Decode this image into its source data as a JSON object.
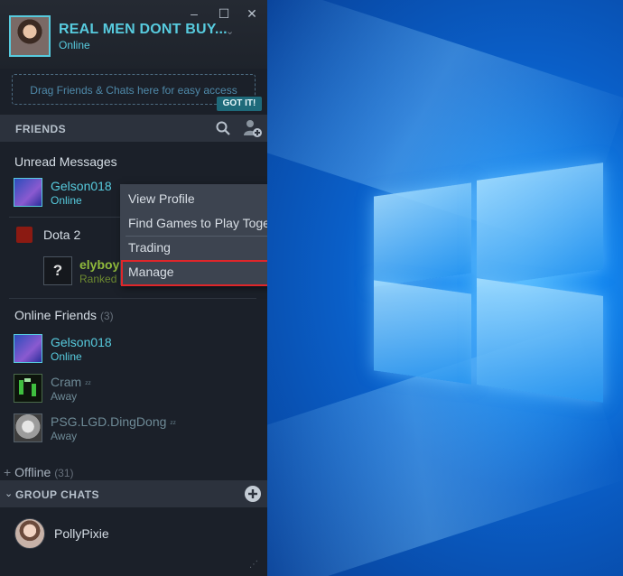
{
  "window": {
    "user_name": "REAL MEN DONT BUY...",
    "user_status": "Online",
    "minimize_glyph": "–",
    "maximize_glyph": "☐",
    "close_glyph": "✕"
  },
  "drag_zone": {
    "text": "Drag Friends & Chats here for easy access",
    "dismiss_label": "GOT IT!"
  },
  "friends_section": {
    "title": "FRIENDS",
    "icons": [
      "search-icon",
      "add-friend-icon"
    ]
  },
  "unread": {
    "title": "Unread Messages",
    "friend": {
      "name": "Gelson018",
      "status": "Online"
    }
  },
  "in_game": {
    "game": "Dota 2",
    "friend": {
      "name": "elyboy",
      "status": "Ranked"
    }
  },
  "online_friends": {
    "title": "Online Friends",
    "count": "(3)",
    "items": [
      {
        "name": "Gelson018",
        "status": "Online"
      },
      {
        "name": "Cram",
        "status": "Away"
      },
      {
        "name": "PSG.LGD.DingDong",
        "status": "Away"
      }
    ]
  },
  "offline": {
    "title": "Offline",
    "count": "(31)"
  },
  "group_chats": {
    "title": "GROUP CHATS",
    "items": [
      {
        "name": "PollyPixie"
      }
    ]
  },
  "context_menu": {
    "items": [
      {
        "label": "View Profile"
      },
      {
        "label": "Find Games to Play Together"
      },
      {
        "label": "Trading",
        "arrow": ">"
      },
      {
        "label": "Manage",
        "arrow": ">"
      }
    ],
    "highlighted": "Manage",
    "highlight_color": "#e0262a"
  },
  "colors": {
    "online": "#57cbde",
    "in_game": "#90ba3c",
    "away": "#6e8a96",
    "panel_bg": "#1b2029",
    "menu_bg": "#3d4450"
  }
}
